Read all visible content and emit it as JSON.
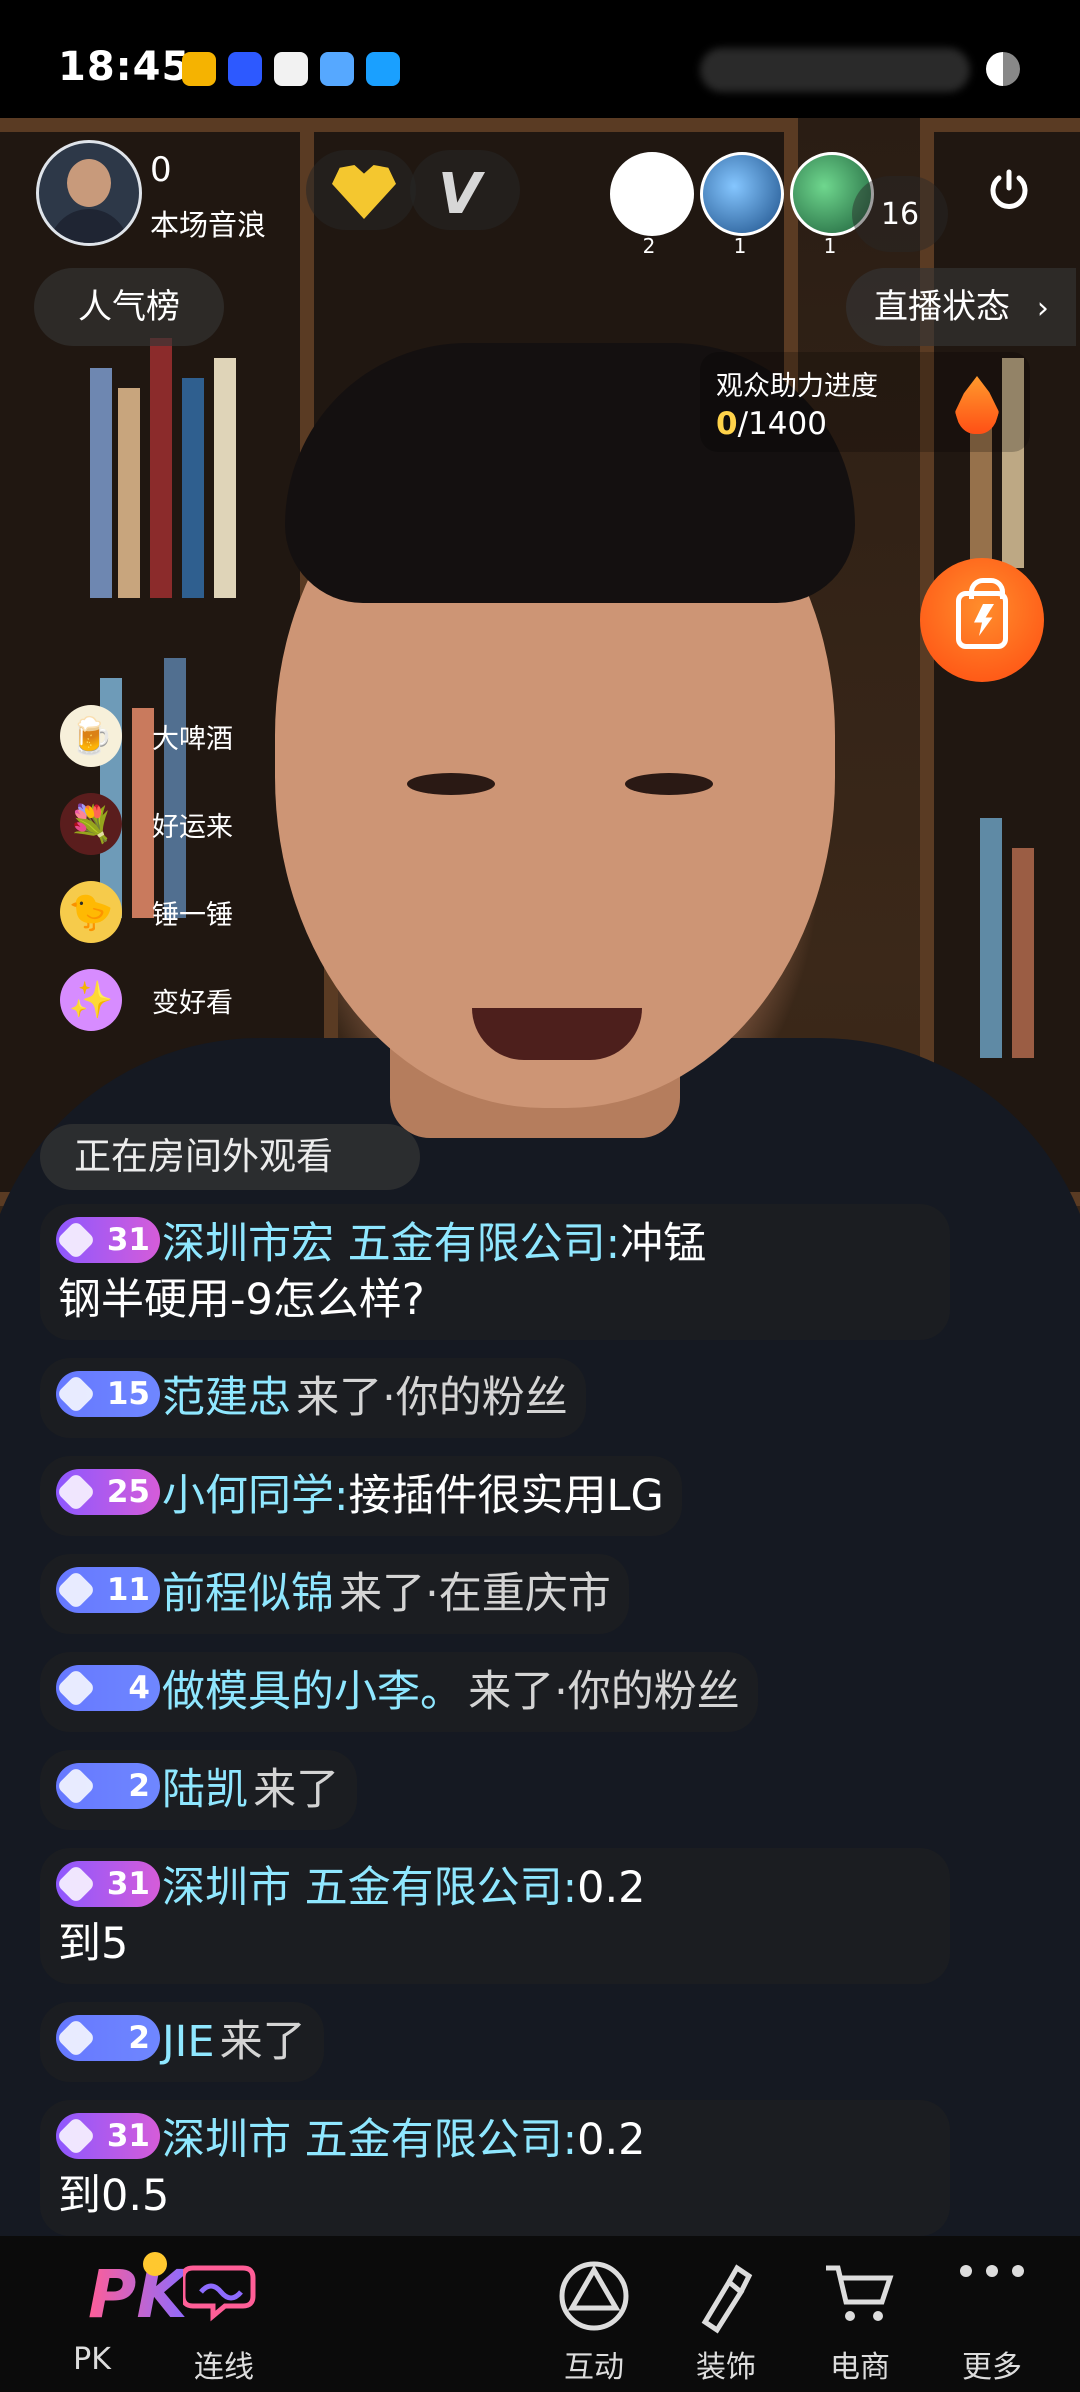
{
  "status": {
    "time": "18:45"
  },
  "live": {
    "score_value": "0",
    "score_label": "本场音浪",
    "fan_count_1": "2",
    "fan_count_2": "1",
    "fan_count_3": "1",
    "viewer_count": "16",
    "ranking_label": "人气榜",
    "live_status_label": "直播状态",
    "assist_title": "观众助力进度",
    "assist_current": "0",
    "assist_total": "/1400"
  },
  "gifts": [
    {
      "label": "大啤酒",
      "icon": "beer-icon"
    },
    {
      "label": "好运来",
      "icon": "bouquet-icon"
    },
    {
      "label": "锤一锤",
      "icon": "duck-icon"
    },
    {
      "label": "变好看",
      "icon": "makeover-icon"
    }
  ],
  "watch_note": "正在房间外观看",
  "chat": [
    {
      "level": "31",
      "badge": "purple",
      "name": "深圳市宏 五金有限公司:",
      "message": "冲锰",
      "wrap": "钢半硬用-9怎么样?",
      "type": "message"
    },
    {
      "level": "15",
      "badge": "blue",
      "name": "范建忠",
      "message": "来了·你的粉丝",
      "type": "join"
    },
    {
      "level": "25",
      "badge": "purple",
      "name": "小何同学:",
      "message": "接插件很实用LG",
      "type": "message"
    },
    {
      "level": "11",
      "badge": "blue",
      "name": "前程似锦",
      "message": "来了·在重庆市",
      "type": "join"
    },
    {
      "level": "4",
      "badge": "blue",
      "name": "做模具的小李。",
      "message": "来了·你的粉丝",
      "type": "join"
    },
    {
      "level": "2",
      "badge": "blue",
      "name": "陆凯",
      "message": "来了",
      "type": "join"
    },
    {
      "level": "31",
      "badge": "purple",
      "name": "深圳市 五金有限公司:",
      "message": "0.2",
      "wrap": "到5",
      "type": "message"
    },
    {
      "level": "2",
      "badge": "blue",
      "name": "JIE",
      "message": "来了",
      "type": "join"
    },
    {
      "level": "31",
      "badge": "purple",
      "name": "深圳市 五金有限公司:",
      "message": "0.2",
      "wrap": "到0.5",
      "type": "message"
    }
  ],
  "bottom_nav": [
    {
      "label": "PK",
      "icon": "pk-icon"
    },
    {
      "label": "连线",
      "icon": "link-icon"
    },
    {
      "label": "互动",
      "icon": "interact-icon"
    },
    {
      "label": "装饰",
      "icon": "decorate-icon"
    },
    {
      "label": "电商",
      "icon": "cart-icon"
    },
    {
      "label": "更多",
      "icon": "more-icon"
    }
  ],
  "colors": {
    "name": "#8fe7ff",
    "badge_purple": "#b55cff",
    "badge_blue": "#6f87ff",
    "gift_orange": "#ff5a1f",
    "pk_pink": "#ff5e97"
  }
}
